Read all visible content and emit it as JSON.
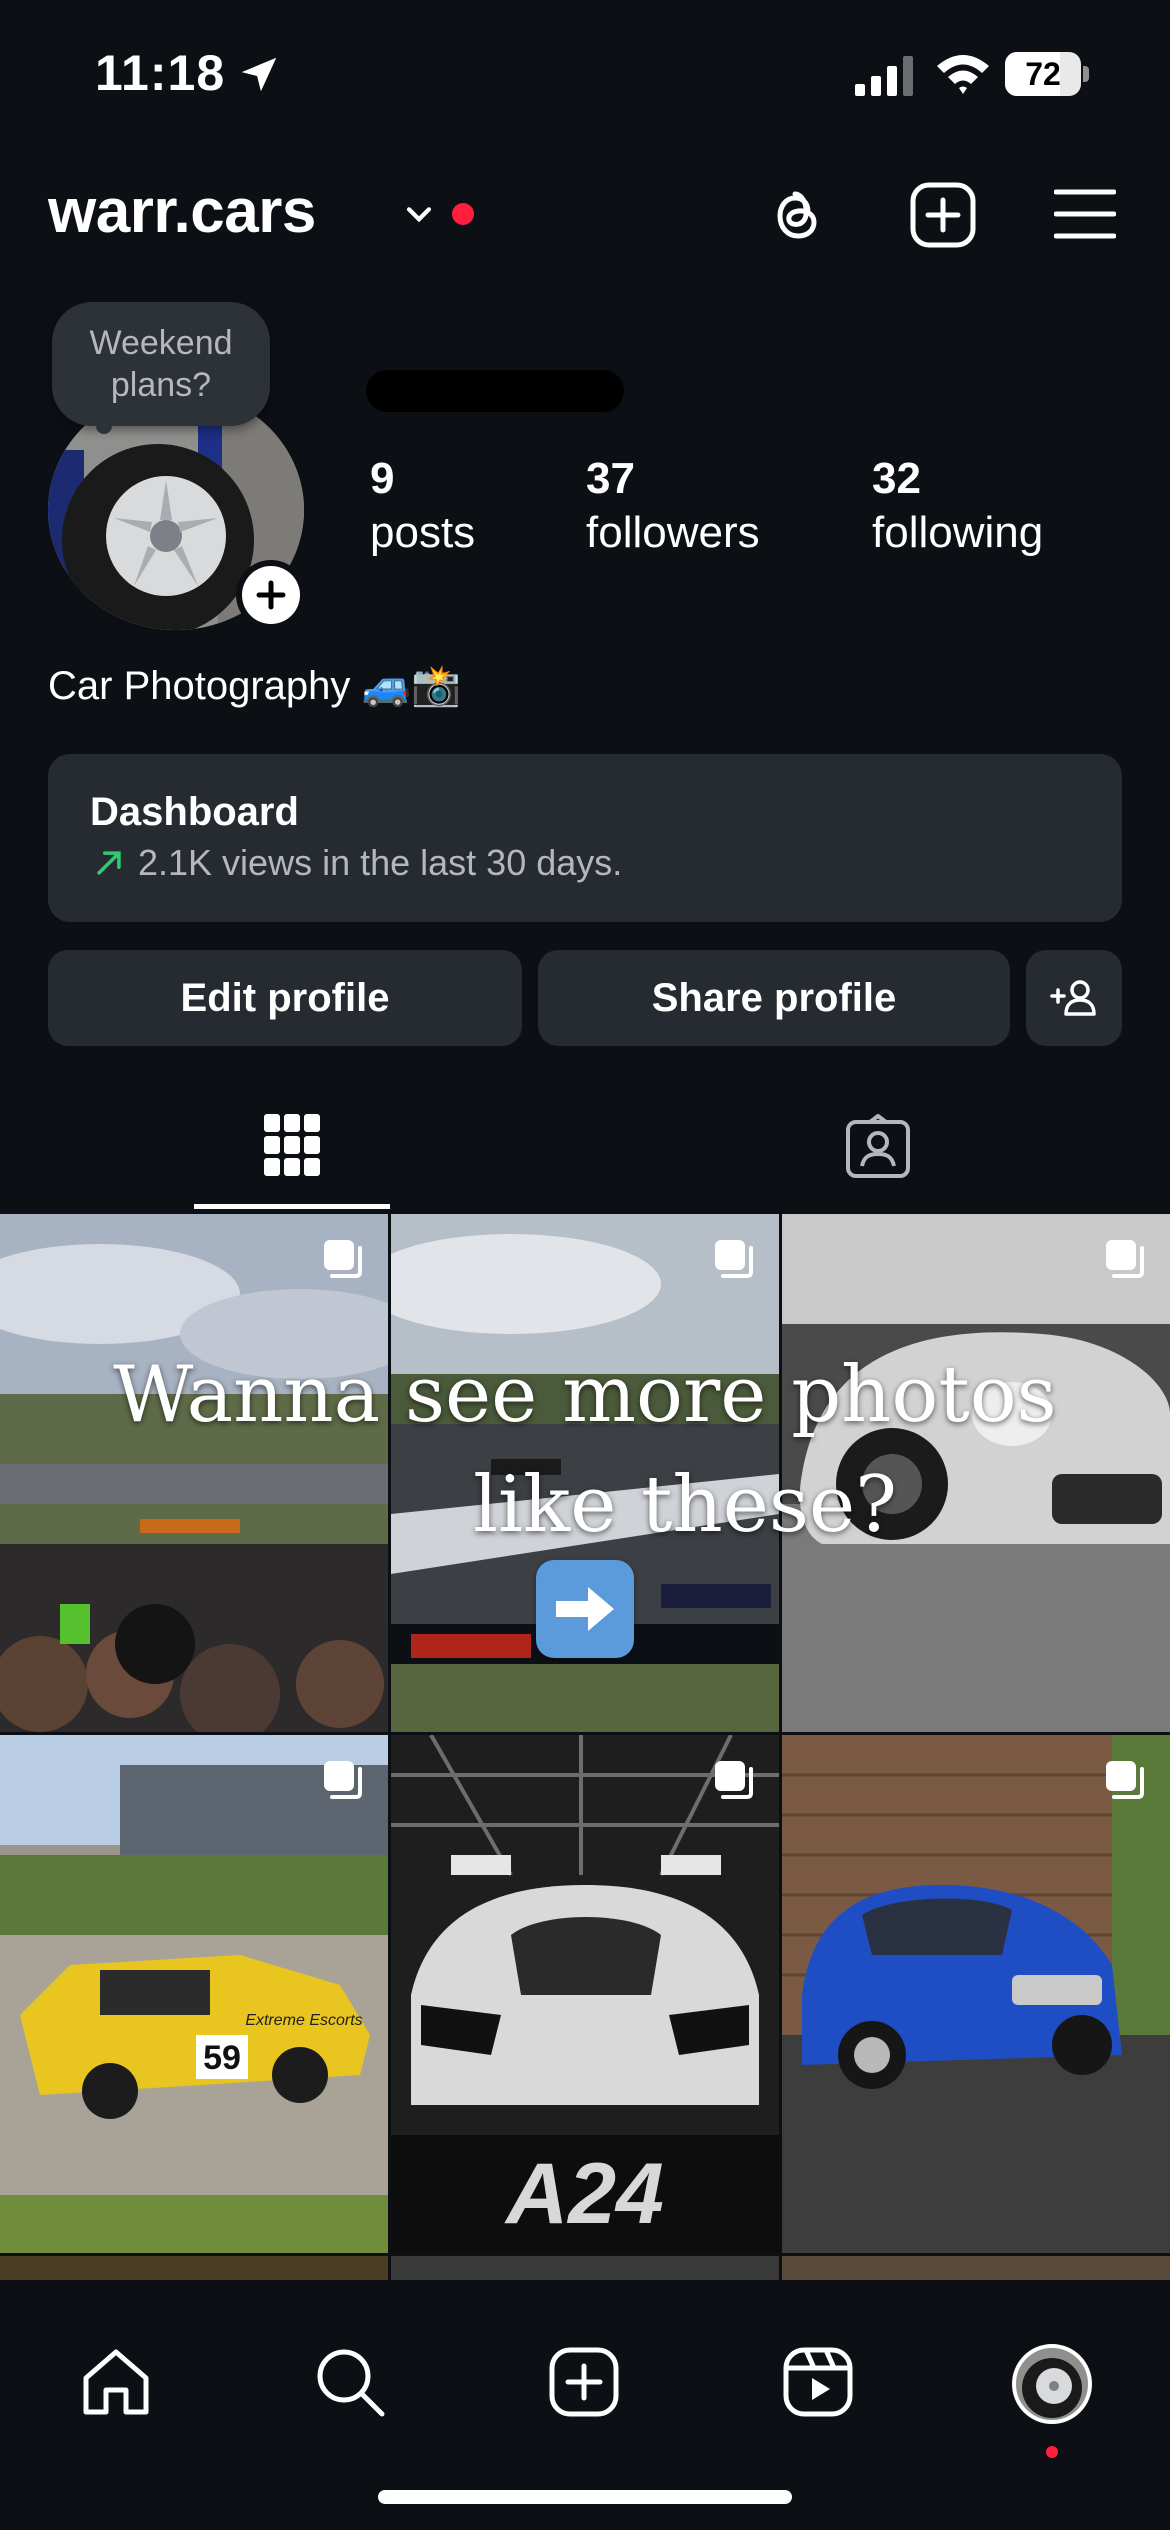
{
  "status_bar": {
    "time": "11:18",
    "battery": "72",
    "battery_level": 0.72
  },
  "header": {
    "username": "warr.cars"
  },
  "profile": {
    "note": "Weekend plans?",
    "stats": [
      {
        "value": "9",
        "label": "posts"
      },
      {
        "value": "37",
        "label": "followers"
      },
      {
        "value": "32",
        "label": "following"
      }
    ],
    "bio": "Car Photography 🚙📸"
  },
  "dashboard": {
    "title": "Dashboard",
    "subtitle": "2.1K views in the last 30 days."
  },
  "buttons": {
    "edit": "Edit profile",
    "share": "Share profile"
  },
  "overlay": {
    "line1": "Wanna see more photos",
    "line2": "like these?",
    "arrow": "➡"
  },
  "posts": [
    {
      "description": "track with F1 cars and spectators"
    },
    {
      "description": "race circuit F1 cars"
    },
    {
      "description": "silver Porsche GT3 black and white"
    },
    {
      "description": "yellow rally Ford Escort number 59"
    },
    {
      "description": "white McLaren 720S A24"
    },
    {
      "description": "blue Suzuki Ignis"
    }
  ],
  "post_texts": {
    "rally_number": "59",
    "rally_brand": "Extreme Escorts",
    "banner": "A24"
  },
  "colors": {
    "background": "#0c0f14",
    "card": "#262a31",
    "accent_red": "#ff1f3d",
    "trend_green": "#2ecc71"
  }
}
